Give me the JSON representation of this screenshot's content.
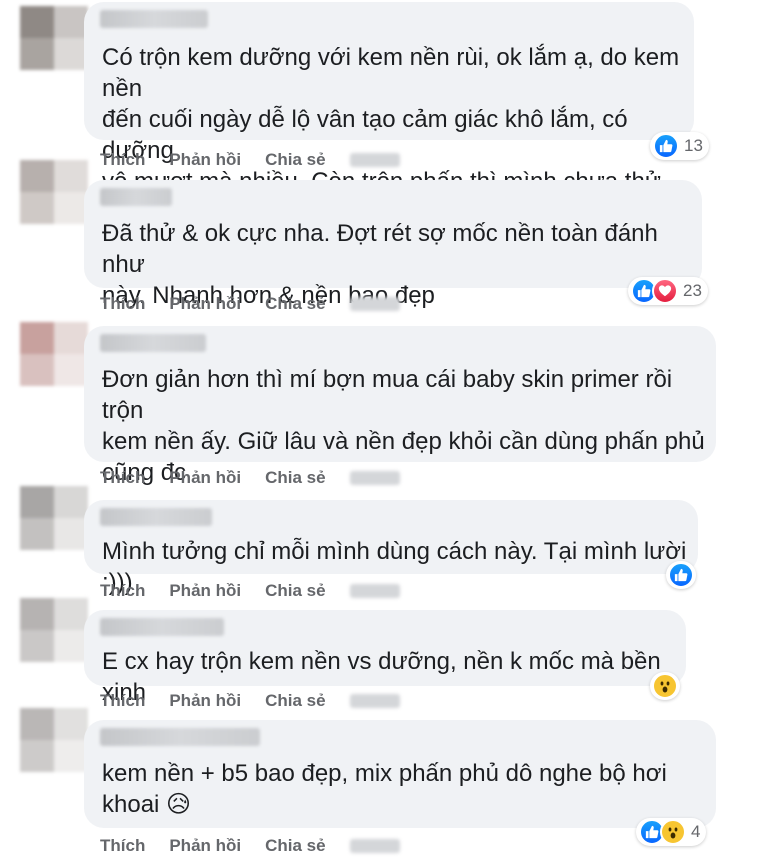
{
  "actions": {
    "like": "Thích",
    "reply": "Phản hồi",
    "share": "Chia sẻ"
  },
  "colors": {
    "like_blue": "#0866ff",
    "heart_red": "#e41e3f",
    "wow_yellow": "#f7c531",
    "bubble": "#f0f2f5"
  },
  "comments": [
    {
      "text": "Có trộn kem dưỡng với kem nền rùi, ok lắm ạ, do kem nền\nđến cuối ngày dễ lộ vân tạo cảm giác khô lắm, có dưỡng\nvô mượt mà nhiều. Còn trộn phấn thì mình chưa thử",
      "reactions": [
        "like"
      ],
      "count": "13"
    },
    {
      "text": "Đã thử & ok cực nha. Đợt rét sợ mốc nền toàn đánh như\nnày. Nhanh hơn & nền bao đẹp",
      "reactions": [
        "like",
        "heart"
      ],
      "count": "23"
    },
    {
      "text": "Đơn giản hơn thì mí bợn mua cái baby skin primer rồi trộn\nkem nền ấy. Giữ lâu và nền đẹp khỏi cần dùng phấn phủ\ncũng đc",
      "reactions": [],
      "count": ""
    },
    {
      "text": "Mình tưởng chỉ mỗi mình dùng cách này. Tại mình lười :)))",
      "reactions": [
        "like"
      ],
      "count": ""
    },
    {
      "text": "E cx hay trộn kem nền vs dưỡng, nền k mốc mà bền xinh",
      "reactions": [
        "wow"
      ],
      "count": ""
    },
    {
      "text": "kem nền + b5 bao đẹp, mix phấn phủ dô nghe bộ hơi\nkhoai 😥",
      "reactions": [
        "like",
        "wow"
      ],
      "count": "4"
    }
  ]
}
